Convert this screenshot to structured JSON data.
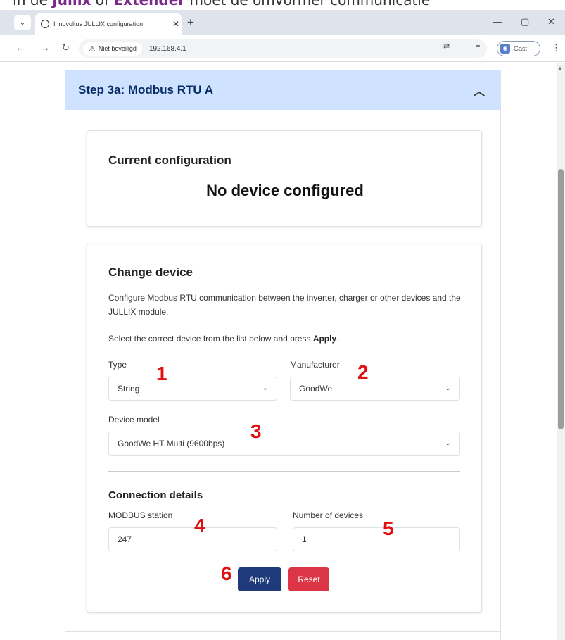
{
  "doc_heading": {
    "prefix": "In de ",
    "brand1": "Jullix",
    "middle": " of ",
    "brand2": "Extender",
    "suffix": " moet de omvormer communicatie"
  },
  "browser": {
    "tab_title": "Innovoltus JULLIX configuration",
    "security_label": "Niet beveiligd",
    "url": "192.168.4.1",
    "profile_label": "Gast"
  },
  "accordion": {
    "title": "Step 3a: Modbus RTU A"
  },
  "current": {
    "heading": "Current configuration",
    "status": "No device configured"
  },
  "change": {
    "heading": "Change device",
    "description": "Configure Modbus RTU communication between the inverter, charger or other devices and the JULLIX module.",
    "instruction_prefix": "Select the correct device from the list below and press ",
    "instruction_bold": "Apply",
    "instruction_suffix": ".",
    "type_label": "Type",
    "type_value": "String",
    "manufacturer_label": "Manufacturer",
    "manufacturer_value": "GoodWe",
    "model_label": "Device model",
    "model_value": "GoodWe HT Multi (9600bps)"
  },
  "connection": {
    "heading": "Connection details",
    "station_label": "MODBUS station",
    "station_value": "247",
    "devices_label": "Number of devices",
    "devices_value": "1",
    "apply_label": "Apply",
    "reset_label": "Reset"
  },
  "badges": {
    "b1": "1",
    "b2": "2",
    "b3": "3",
    "b4": "4",
    "b5": "5",
    "b6": "6"
  },
  "colors": {
    "accordion_bg": "#cfe2ff",
    "apply_button": "#1e3a7b",
    "reset_button": "#dc3545",
    "badge_red": "#e01010"
  },
  "icons": [
    "chevron-down-icon",
    "globe-icon",
    "close-icon",
    "plus-icon",
    "minimize-icon",
    "maximize-icon",
    "back-icon",
    "forward-icon",
    "reload-icon",
    "warning-icon",
    "translate-icon",
    "cast-icon",
    "kebab-icon",
    "chevron-up-icon"
  ]
}
